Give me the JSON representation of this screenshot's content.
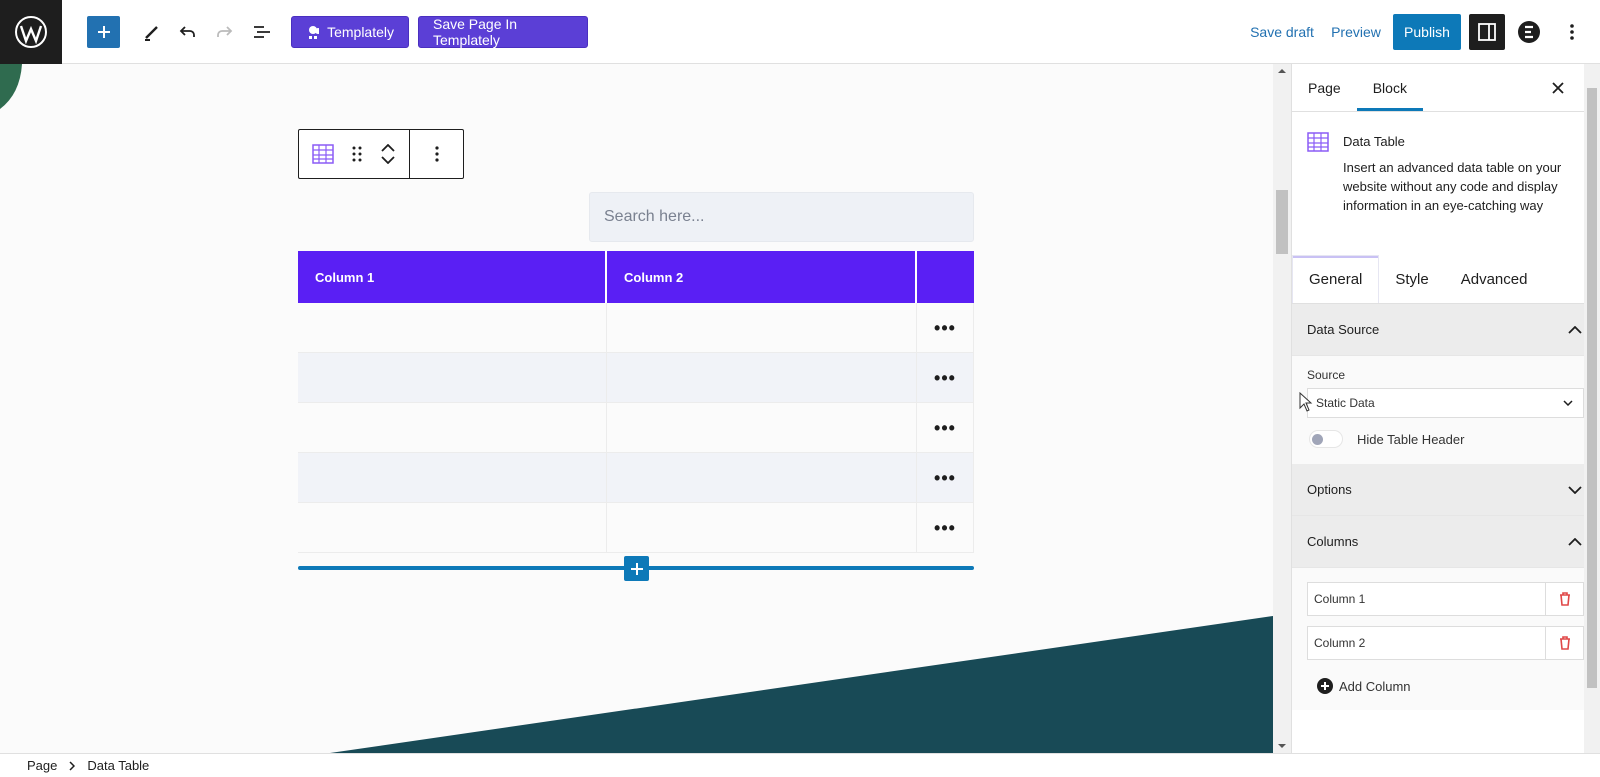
{
  "toolbar": {
    "templately_label": "Templately",
    "save_in_templately_label": "Save Page In Templately",
    "save_draft_label": "Save draft",
    "preview_label": "Preview",
    "publish_label": "Publish"
  },
  "canvas": {
    "search_placeholder": "Search here...",
    "table": {
      "headers": [
        "Column 1",
        "Column 2",
        ""
      ],
      "row_count": 5,
      "row_action": "•••"
    }
  },
  "sidebar": {
    "tabs": [
      "Page",
      "Block"
    ],
    "active_tab": "Block",
    "block": {
      "name": "Data Table",
      "description": "Insert an advanced data table on your website without any code and display information in an eye-catching way"
    },
    "editor_tabs": [
      "General",
      "Style",
      "Advanced"
    ],
    "active_editor_tab": "General",
    "data_source": {
      "title": "Data Source",
      "source_label": "Source",
      "source_value": "Static Data",
      "hide_header_label": "Hide Table Header",
      "hide_header_on": false
    },
    "options": {
      "title": "Options"
    },
    "columns": {
      "title": "Columns",
      "items": [
        "Column 1",
        "Column 2"
      ],
      "add_label": "Add Column"
    }
  },
  "breadcrumb": [
    "Page",
    "Data Table"
  ],
  "colors": {
    "accent": "#0d79b8",
    "templately": "#5b3fd6",
    "table_header": "#5a1ff4",
    "delete": "#e04848"
  }
}
